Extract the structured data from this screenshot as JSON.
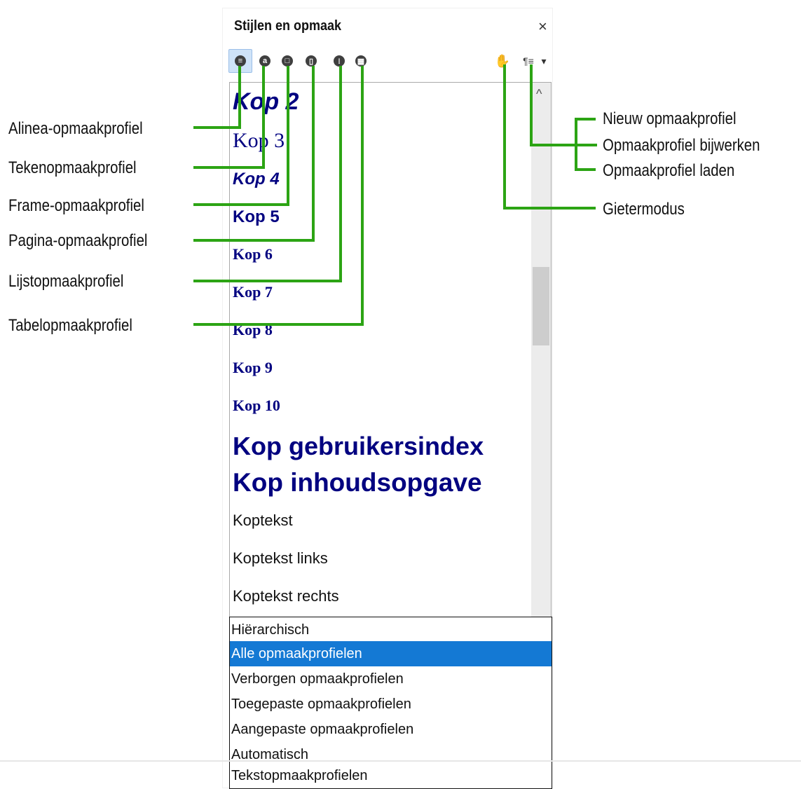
{
  "panel": {
    "title": "Stijlen en opmaak",
    "close": "×"
  },
  "toolbar": {
    "buttons": [
      {
        "name": "alinea",
        "glyph": "≡"
      },
      {
        "name": "teken",
        "glyph": "a"
      },
      {
        "name": "frame",
        "glyph": "□"
      },
      {
        "name": "pagina",
        "glyph": "▯"
      },
      {
        "name": "lijst",
        "glyph": "⁝"
      },
      {
        "name": "tabel",
        "glyph": "▦"
      }
    ],
    "fill_icon": "✋",
    "new_style_glyph": "¶≡",
    "dropdown_arrow": "▾"
  },
  "styles": [
    "Kop 2",
    "Kop 3",
    "Kop 4",
    "Kop 5",
    "Kop 6",
    "Kop 7",
    "Kop 8",
    "Kop 9",
    "Kop 10",
    "Kop gebruikersindex",
    "Kop inhoudsopgave",
    "Koptekst",
    "Koptekst links",
    "Koptekst rechts"
  ],
  "filter_options": [
    "Hiërarchisch",
    "Alle opmaakprofielen",
    "Verborgen opmaakprofielen",
    "Toegepaste opmaakprofielen",
    "Aangepaste opmaakprofielen",
    "Automatisch",
    "Tekstopmaakprofielen"
  ],
  "selected_filter": "Alle opmaakprofielen",
  "callouts_left": [
    "Alinea-opmaakprofiel",
    "Tekenopmaakprofiel",
    "Frame-opmaakprofiel",
    "Pagina-opmaakprofiel",
    "Lijstopmaakprofiel",
    "Tabelopmaakprofiel"
  ],
  "callouts_right": [
    "Nieuw opmaakprofiel",
    "Opmaakprofiel bijwerken",
    "Opmaakprofiel laden",
    "Gietermodus"
  ],
  "colors": {
    "callout_line": "#2ca414",
    "heading_text": "#000080",
    "selection": "#1479d4"
  }
}
